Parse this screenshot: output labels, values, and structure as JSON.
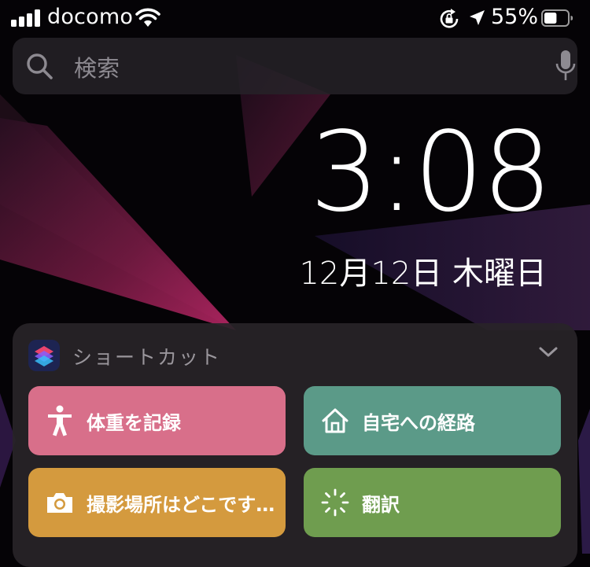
{
  "status_bar": {
    "carrier": "docomo",
    "battery_percent": "55%",
    "battery_level": 0.55
  },
  "search": {
    "placeholder": "検索"
  },
  "clock": {
    "time": "3:08",
    "date": "12月12日 木曜日"
  },
  "widget": {
    "app_name": "ショートカット",
    "shortcuts": [
      {
        "label": "体重を記録",
        "icon": "accessibility-person-icon",
        "color": "#d86f8a"
      },
      {
        "label": "自宅への経路",
        "icon": "house-icon",
        "color": "#5b9a88"
      },
      {
        "label": "撮影場所はどこです…",
        "icon": "camera-icon",
        "color": "#d49a3e"
      },
      {
        "label": "翻訳",
        "icon": "sparkle-burst-icon",
        "color": "#6f9d4f"
      }
    ]
  },
  "colors": {
    "wallpaper_accent": "#8a1f4e",
    "search_bg": "#262228",
    "widget_bg": "#282428"
  }
}
